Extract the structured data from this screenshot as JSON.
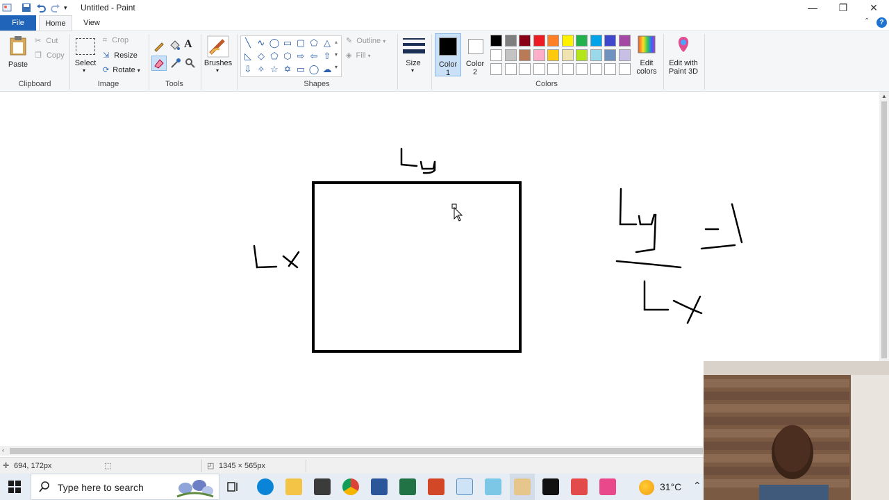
{
  "window": {
    "title": "Untitled - Paint",
    "minimize": "—",
    "restore": "❐",
    "close": "✕"
  },
  "menu": {
    "file": "File",
    "home": "Home",
    "view": "View"
  },
  "clipboard": {
    "paste": "Paste",
    "cut": "Cut",
    "copy": "Copy",
    "label": "Clipboard"
  },
  "image": {
    "select": "Select",
    "crop": "Crop",
    "resize": "Resize",
    "rotate": "Rotate",
    "label": "Image"
  },
  "tools": {
    "label": "Tools"
  },
  "brushes": {
    "label": "Brushes"
  },
  "shapes": {
    "outline": "Outline",
    "fill": "Fill",
    "label": "Shapes"
  },
  "size": {
    "label": "Size"
  },
  "colors": {
    "color1_line1": "Color",
    "color1_line2": "1",
    "color2_line1": "Color",
    "color2_line2": "2",
    "edit_line1": "Edit",
    "edit_line2": "colors",
    "paint3d_line1": "Edit with",
    "paint3d_line2": "Paint 3D",
    "label": "Colors",
    "color1_value": "#000000",
    "color2_value": "#ffffff",
    "palette_row1": [
      "#000000",
      "#7f7f7f",
      "#880015",
      "#ed1c24",
      "#ff7f27",
      "#fff200",
      "#22b14c",
      "#00a2e8",
      "#3f48cc",
      "#a349a4"
    ],
    "palette_row2": [
      "#ffffff",
      "#c3c3c3",
      "#b97a57",
      "#ffaec9",
      "#ffc90e",
      "#efe4b0",
      "#b5e61d",
      "#99d9ea",
      "#7092be",
      "#c8bfe7"
    ]
  },
  "canvas_text": {
    "ly_top": "Ly",
    "lx_left": "Lx"
  },
  "status": {
    "cursor_pos": "694, 172px",
    "canvas_size": "1345 × 565px"
  },
  "taskbar": {
    "search_placeholder": "Type here to search",
    "weather": "31°C"
  }
}
